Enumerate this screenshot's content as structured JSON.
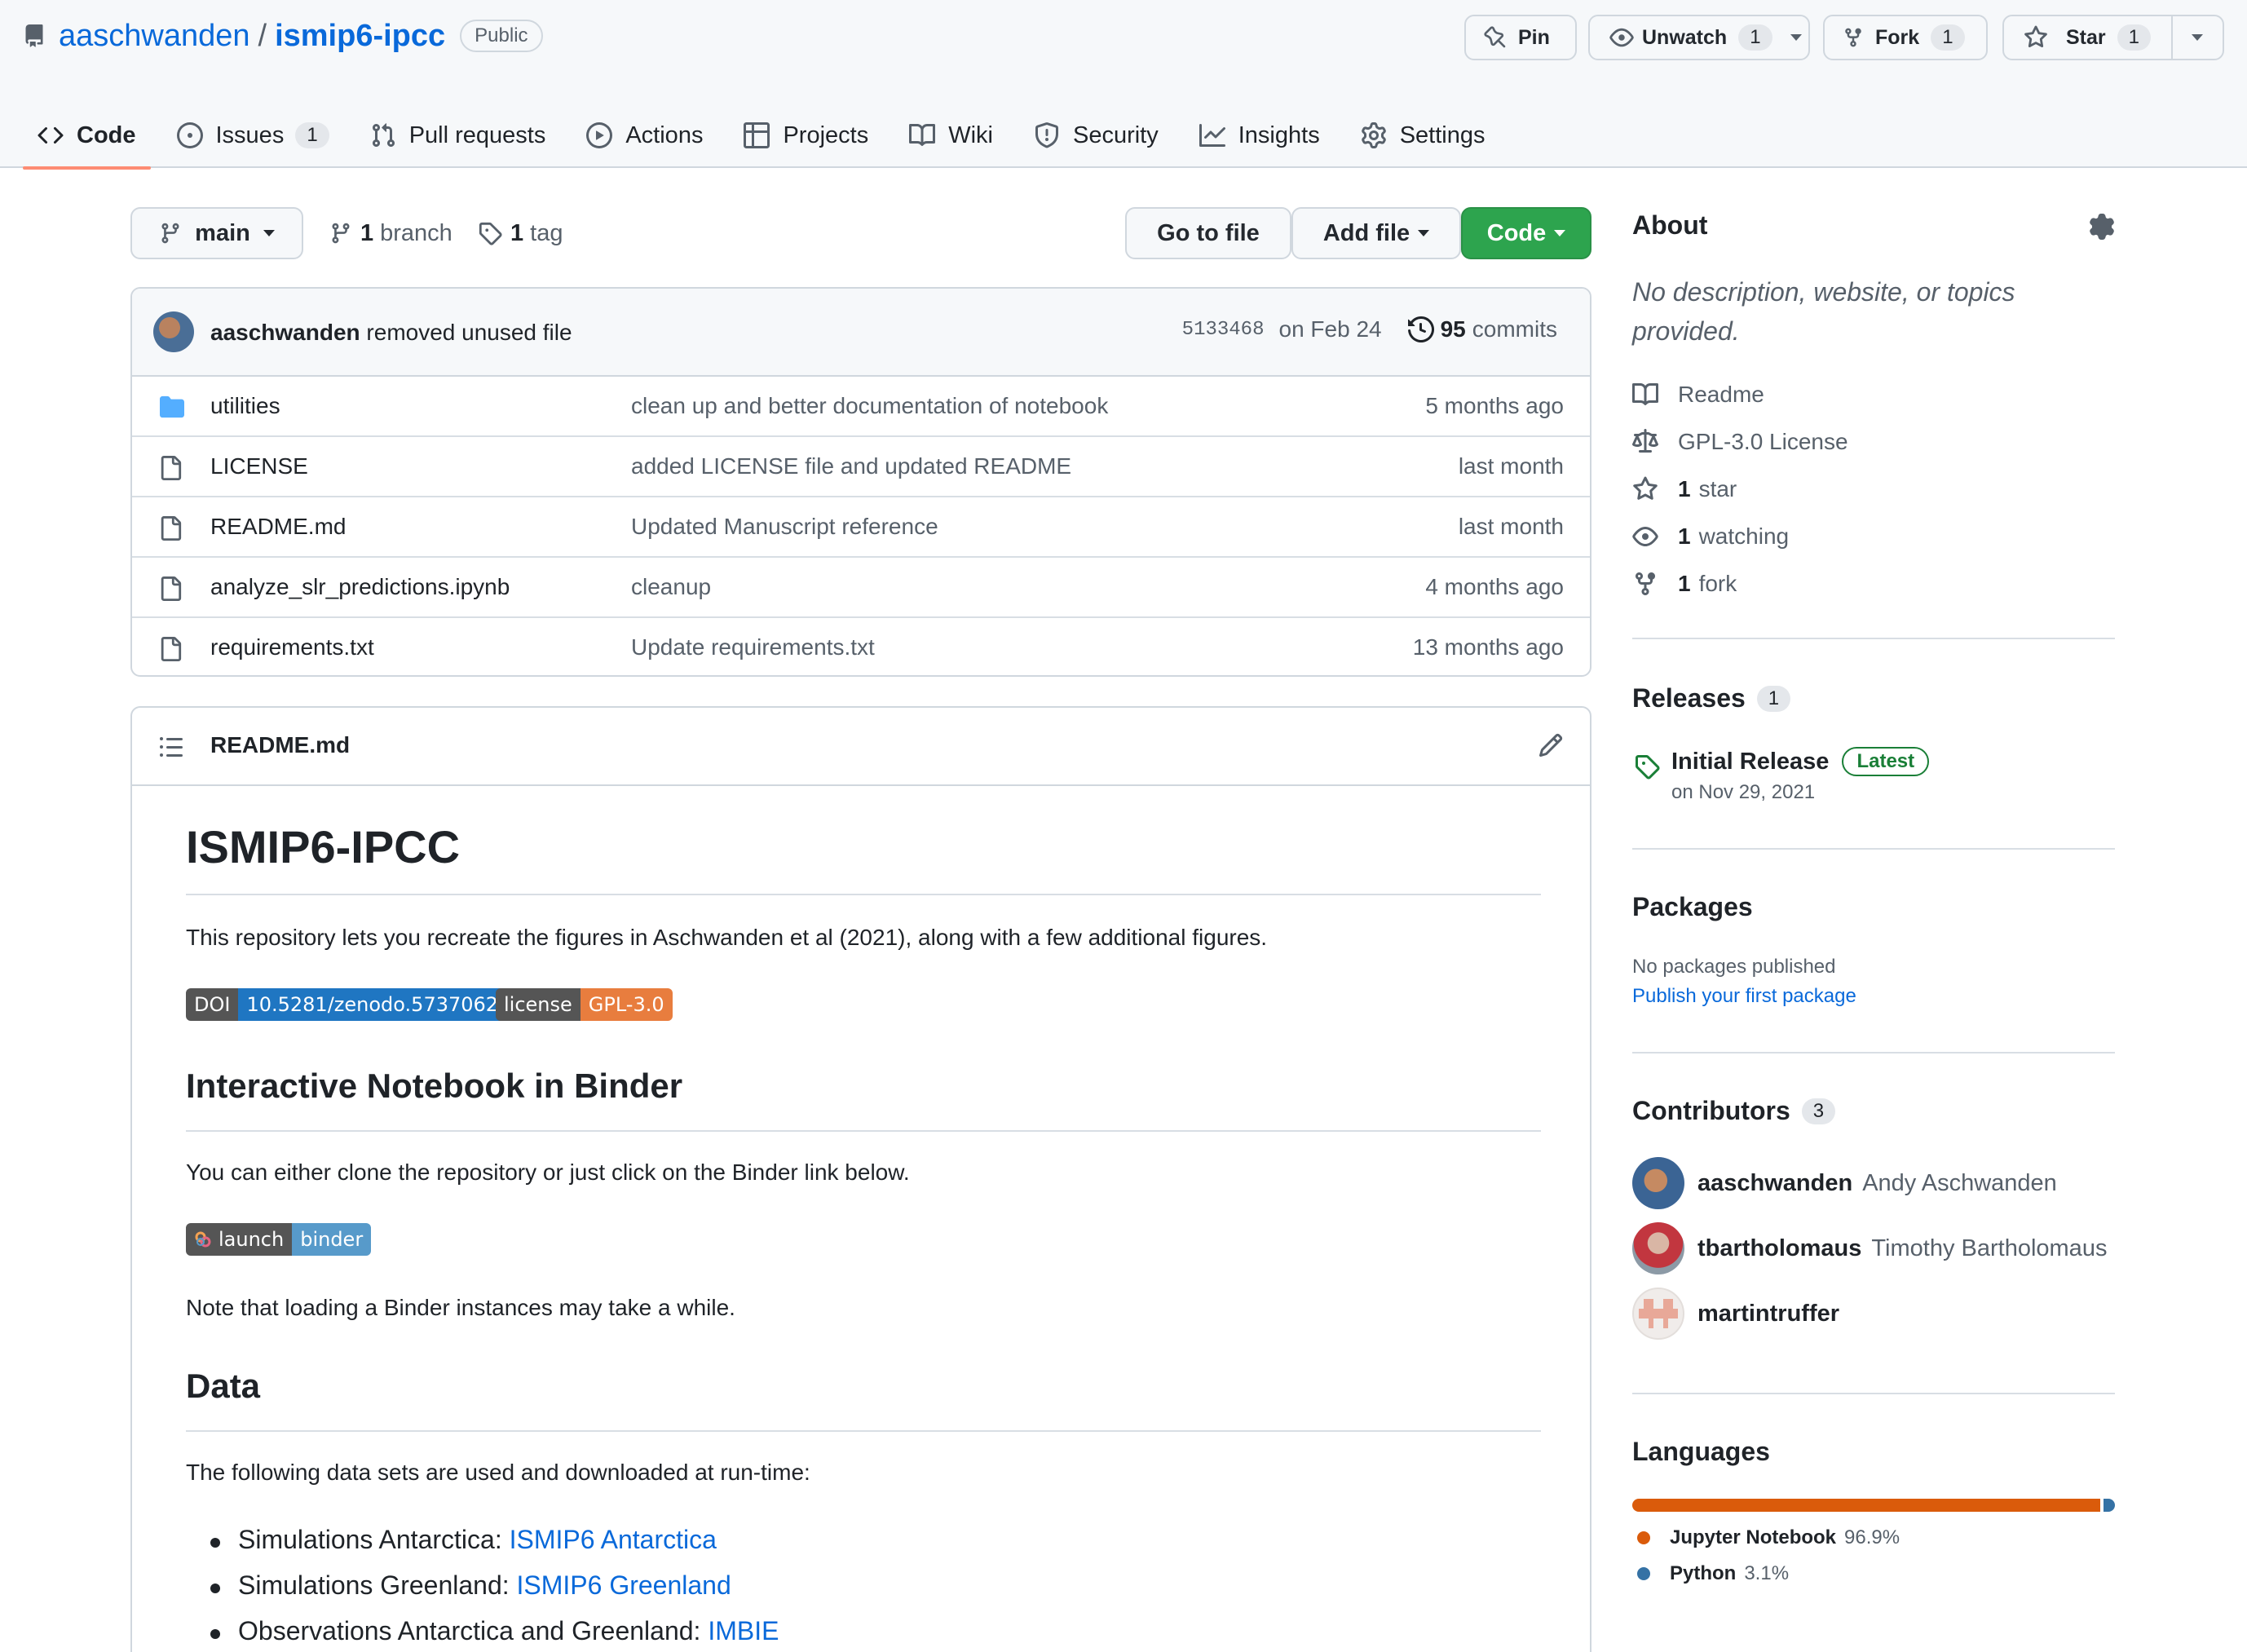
{
  "repo": {
    "owner": "aaschwanden",
    "slash": "/",
    "name": "ismip6-ipcc",
    "visibility": "Public"
  },
  "header_actions": {
    "pin": "Pin",
    "unwatch": "Unwatch",
    "unwatch_count": "1",
    "fork": "Fork",
    "fork_count": "1",
    "star": "Star",
    "star_count": "1"
  },
  "tabs": [
    {
      "label": "Code",
      "icon": "code-icon"
    },
    {
      "label": "Issues",
      "count": "1",
      "icon": "issue-icon"
    },
    {
      "label": "Pull requests",
      "icon": "pull-request-icon"
    },
    {
      "label": "Actions",
      "icon": "play-icon"
    },
    {
      "label": "Projects",
      "icon": "table-icon"
    },
    {
      "label": "Wiki",
      "icon": "book-icon"
    },
    {
      "label": "Security",
      "icon": "shield-icon"
    },
    {
      "label": "Insights",
      "icon": "graph-icon"
    },
    {
      "label": "Settings",
      "icon": "gear-icon"
    }
  ],
  "toolbar": {
    "branch": "main",
    "branch_count": "1",
    "branch_label": "branch",
    "tag_count": "1",
    "tag_label": "tag",
    "go_to_file": "Go to file",
    "add_file": "Add file",
    "code": "Code"
  },
  "latest_commit": {
    "author": "aaschwanden",
    "message": "removed unused file",
    "sha": "5133468",
    "date": "on Feb 24",
    "commit_count": "95",
    "commit_label": "commits"
  },
  "files": [
    {
      "name": "utilities",
      "type": "folder",
      "message": "clean up and better documentation of notebook",
      "age": "5 months ago"
    },
    {
      "name": "LICENSE",
      "type": "file",
      "message": "added LICENSE file and updated README",
      "age": "last month"
    },
    {
      "name": "README.md",
      "type": "file",
      "message": "Updated Manuscript reference",
      "age": "last month"
    },
    {
      "name": "analyze_slr_predictions.ipynb",
      "type": "file",
      "message": "cleanup",
      "age": "4 months ago"
    },
    {
      "name": "requirements.txt",
      "type": "file",
      "message": "Update requirements.txt",
      "age": "13 months ago"
    }
  ],
  "readme": {
    "filename": "README.md",
    "title": "ISMIP6-IPCC",
    "intro": "This repository lets you recreate the figures in Aschwanden et al (2021), along with a few additional figures.",
    "doi_badge": {
      "left": "DOI",
      "right": "10.5281/zenodo.5737062",
      "right_color": "#1f76c2"
    },
    "license_badge": {
      "left": "license",
      "right": "GPL-3.0",
      "right_color": "#e05d44"
    },
    "h2_binder": "Interactive Notebook in Binder",
    "binder_text": "You can either clone the repository or just click on the Binder link below.",
    "binder_badge": {
      "left": "launch",
      "right": "binder",
      "right_color": "#579aca"
    },
    "binder_note": "Note that loading a Binder instances may take a while.",
    "h2_data": "Data",
    "data_text": "The following data sets are used and downloaded at run-time:",
    "data_items": [
      {
        "label": "Simulations Antarctica: ",
        "link": "ISMIP6 Antarctica"
      },
      {
        "label": "Simulations Greenland: ",
        "link": "ISMIP6 Greenland"
      },
      {
        "label": "Observations Antarctica and Greenland: ",
        "link": "IMBIE"
      }
    ]
  },
  "about": {
    "title": "About",
    "description": "No description, website, or topics provided.",
    "readme": "Readme",
    "license": "GPL-3.0 License",
    "stars_count": "1",
    "stars_label": "star",
    "watching_count": "1",
    "watching_label": "watching",
    "forks_count": "1",
    "forks_label": "fork"
  },
  "releases": {
    "title": "Releases",
    "count": "1",
    "name": "Initial Release",
    "badge": "Latest",
    "date": "on Nov 29, 2021"
  },
  "packages": {
    "title": "Packages",
    "none": "No packages published",
    "link": "Publish your first package"
  },
  "contributors": {
    "title": "Contributors",
    "count": "3",
    "people": [
      {
        "login": "aaschwanden",
        "name": "Andy Aschwanden"
      },
      {
        "login": "tbartholomaus",
        "name": "Timothy Bartholomaus"
      },
      {
        "login": "martintruffer",
        "name": ""
      }
    ]
  },
  "languages": {
    "title": "Languages",
    "items": [
      {
        "name": "Jupyter Notebook",
        "percent": "96.9%",
        "value": 96.9,
        "color": "#DA5B0B"
      },
      {
        "name": "Python",
        "percent": "3.1%",
        "value": 3.1,
        "color": "#3572A5"
      }
    ]
  }
}
